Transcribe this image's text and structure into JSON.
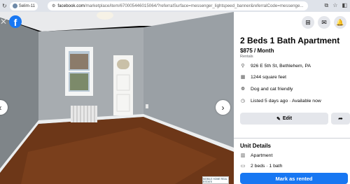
{
  "browser": {
    "profile_label": "Selim-11",
    "url_domain": "facebook.com",
    "url_rest": "/marketplace/item/670005446015064/?referralSurface=messenger_lightspeed_banner&referralCode=messenge..."
  },
  "viewer": {
    "prev_icon": "chevron-left-icon",
    "next_icon": "chevron-right-icon",
    "watermark_text": "MOBILE HOME REAL ESTATE"
  },
  "listing": {
    "title": "2 Beds 1 Bath Apartment",
    "price": "$875 / Month",
    "category": "Rentals",
    "details": [
      {
        "icon": "location-pin-icon",
        "text": "926 E 5th St, Bethlehem, PA"
      },
      {
        "icon": "floor-plan-icon",
        "text": "1244 square feet"
      },
      {
        "icon": "paw-icon",
        "text": "Dog and cat friendly"
      },
      {
        "icon": "clock-icon",
        "text": "Listed 5 days ago · Available now"
      }
    ],
    "edit_label": "Edit",
    "section_title": "Unit Details",
    "unit_details": [
      {
        "icon": "apartment-icon",
        "text": "Apartment"
      },
      {
        "icon": "bed-icon",
        "text": "2 beds · 1 bath"
      }
    ],
    "mark_label": "Mark as rented"
  },
  "colors": {
    "primary": "#1877f2",
    "button_bg": "#e4e6eb"
  }
}
